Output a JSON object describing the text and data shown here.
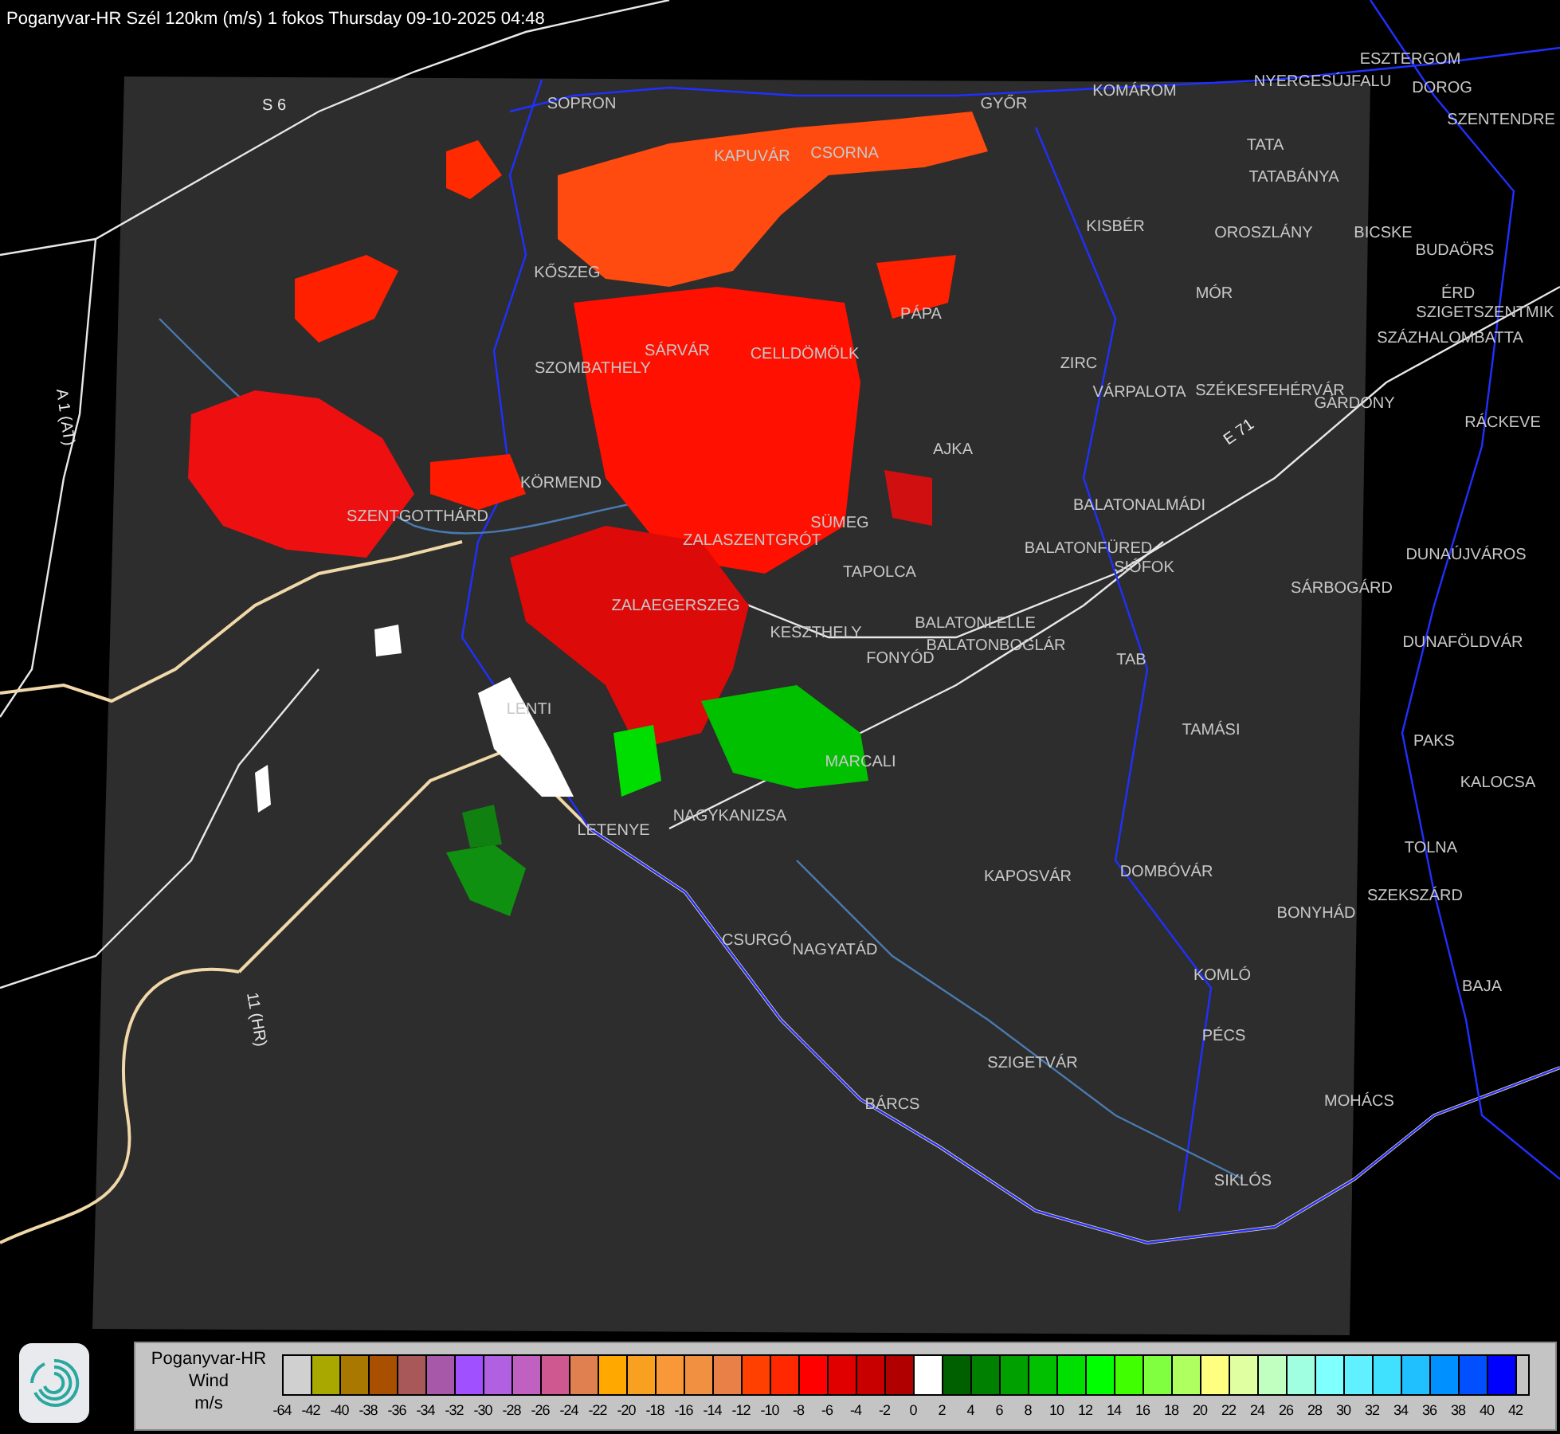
{
  "title": "Poganyvar-HR Szél 120km (m/s) 1 fokos Thursday 09-10-2025 04:48",
  "map": {
    "labels": [
      {
        "text": "S 6",
        "kind": "road"
      },
      {
        "text": "SOPRON",
        "kind": "city"
      },
      {
        "text": "KAPUVÁR",
        "kind": "city"
      },
      {
        "text": "CSORNA",
        "kind": "city"
      },
      {
        "text": "GYŐR",
        "kind": "city"
      },
      {
        "text": "KOMÁROM",
        "kind": "city"
      },
      {
        "text": "ESZTERGOM",
        "kind": "city"
      },
      {
        "text": "NYERGESÚJFALU",
        "kind": "city"
      },
      {
        "text": "DOROG",
        "kind": "city"
      },
      {
        "text": "SZENTENDRE",
        "kind": "city"
      },
      {
        "text": "TATA",
        "kind": "city"
      },
      {
        "text": "TATABÁNYA",
        "kind": "city"
      },
      {
        "text": "KISBÉR",
        "kind": "city"
      },
      {
        "text": "OROSZLÁNY",
        "kind": "city"
      },
      {
        "text": "BICSKE",
        "kind": "city"
      },
      {
        "text": "BUDAÖRS",
        "kind": "city"
      },
      {
        "text": "ÉRD",
        "kind": "city"
      },
      {
        "text": "SZIGETSZENTMIK",
        "kind": "city"
      },
      {
        "text": "SZÁZHALOMBATTA",
        "kind": "city"
      },
      {
        "text": "MÓR",
        "kind": "city"
      },
      {
        "text": "KŐSZEG",
        "kind": "city"
      },
      {
        "text": "PÁPA",
        "kind": "city"
      },
      {
        "text": "SÁRVÁR",
        "kind": "city"
      },
      {
        "text": "CELLDÖMÖLK",
        "kind": "city"
      },
      {
        "text": "SZOMBATHELY",
        "kind": "city"
      },
      {
        "text": "ZIRC",
        "kind": "city"
      },
      {
        "text": "VÁRPALOTA",
        "kind": "city"
      },
      {
        "text": "SZÉKESFEHÉRVÁR",
        "kind": "city"
      },
      {
        "text": "GÁRDONY",
        "kind": "city"
      },
      {
        "text": "RÁCKEVE",
        "kind": "city"
      },
      {
        "text": "AJKA",
        "kind": "city"
      },
      {
        "text": "KÖRMEND",
        "kind": "city"
      },
      {
        "text": "SZENTGOTTHÁRD",
        "kind": "city"
      },
      {
        "text": "BALATONALMÁDI",
        "kind": "city"
      },
      {
        "text": "SÜMEG",
        "kind": "city"
      },
      {
        "text": "ZALASZENTGRÓT",
        "kind": "city"
      },
      {
        "text": "BALATONFÜRED",
        "kind": "city"
      },
      {
        "text": "DUNAÚJVÁROS",
        "kind": "city"
      },
      {
        "text": "SIÓFOK",
        "kind": "city"
      },
      {
        "text": "TAPOLCA",
        "kind": "city"
      },
      {
        "text": "SÁRBOGÁRD",
        "kind": "city"
      },
      {
        "text": "ZALAEGERSZEG",
        "kind": "city"
      },
      {
        "text": "KESZTHELY",
        "kind": "city"
      },
      {
        "text": "BALATONLELLE",
        "kind": "city"
      },
      {
        "text": "BALATONBOGLÁR",
        "kind": "city"
      },
      {
        "text": "FONYÓD",
        "kind": "city"
      },
      {
        "text": "DUNAFÖLDVÁR",
        "kind": "city"
      },
      {
        "text": "TAB",
        "kind": "city"
      },
      {
        "text": "LENTI",
        "kind": "city"
      },
      {
        "text": "TAMÁSI",
        "kind": "city"
      },
      {
        "text": "PAKS",
        "kind": "city"
      },
      {
        "text": "MARCALI",
        "kind": "city"
      },
      {
        "text": "KALOCSA",
        "kind": "city"
      },
      {
        "text": "NAGYKANIZSA",
        "kind": "city"
      },
      {
        "text": "LETENYE",
        "kind": "city"
      },
      {
        "text": "TOLNA",
        "kind": "city"
      },
      {
        "text": "KAPOSVÁR",
        "kind": "city"
      },
      {
        "text": "DOMBÓVÁR",
        "kind": "city"
      },
      {
        "text": "SZEKSZÁRD",
        "kind": "city"
      },
      {
        "text": "BONYHÁD",
        "kind": "city"
      },
      {
        "text": "CSURGÓ",
        "kind": "city"
      },
      {
        "text": "NAGYATÁD",
        "kind": "city"
      },
      {
        "text": "KOMLÓ",
        "kind": "city"
      },
      {
        "text": "BAJA",
        "kind": "city"
      },
      {
        "text": "PÉCS",
        "kind": "city"
      },
      {
        "text": "SZIGETVÁR",
        "kind": "city"
      },
      {
        "text": "MOHÁCS",
        "kind": "city"
      },
      {
        "text": "BÁRCS",
        "kind": "city"
      },
      {
        "text": "SIKLÓS",
        "kind": "city"
      },
      {
        "text": "11 (HR)",
        "kind": "road"
      },
      {
        "text": "A 1 (AT)",
        "kind": "road"
      },
      {
        "text": "E 71",
        "kind": "road"
      }
    ]
  },
  "legend": {
    "title_lines": [
      "Poganyvar-HR",
      "Wind",
      "m/s"
    ],
    "swatches": [
      {
        "color": "#d0d0d0"
      },
      {
        "color": "#a8a800"
      },
      {
        "color": "#a87800"
      },
      {
        "color": "#a85000"
      },
      {
        "color": "#a85858"
      },
      {
        "color": "#a858a8"
      },
      {
        "color": "#a050ff"
      },
      {
        "color": "#b060e0"
      },
      {
        "color": "#c060c0"
      },
      {
        "color": "#d05890"
      },
      {
        "color": "#e08050"
      },
      {
        "color": "#ffa800"
      },
      {
        "color": "#f8a020"
      },
      {
        "color": "#f89838"
      },
      {
        "color": "#f09040"
      },
      {
        "color": "#e88048"
      },
      {
        "color": "#ff4000"
      },
      {
        "color": "#ff2800"
      },
      {
        "color": "#ff0000"
      },
      {
        "color": "#e00000"
      },
      {
        "color": "#c80000"
      },
      {
        "color": "#b00000"
      },
      {
        "color": "#ffffff"
      },
      {
        "color": "#006000"
      },
      {
        "color": "#008000"
      },
      {
        "color": "#00a000"
      },
      {
        "color": "#00c000"
      },
      {
        "color": "#00e000"
      },
      {
        "color": "#00ff00"
      },
      {
        "color": "#40ff00"
      },
      {
        "color": "#80ff40"
      },
      {
        "color": "#b0ff60"
      },
      {
        "color": "#ffff80"
      },
      {
        "color": "#e0ffa0"
      },
      {
        "color": "#c0ffc0"
      },
      {
        "color": "#a0ffe0"
      },
      {
        "color": "#80ffff"
      },
      {
        "color": "#60f0ff"
      },
      {
        "color": "#40e0ff"
      },
      {
        "color": "#20c0ff"
      },
      {
        "color": "#0090ff"
      },
      {
        "color": "#0050ff"
      },
      {
        "color": "#0000ff"
      }
    ],
    "ticks": [
      "-64",
      "-42",
      "-40",
      "-38",
      "-36",
      "-34",
      "-32",
      "-30",
      "-28",
      "-26",
      "-24",
      "-22",
      "-20",
      "-18",
      "-16",
      "-14",
      "-12",
      "-10",
      "-8",
      "-6",
      "-4",
      "-2",
      "0",
      "2",
      "4",
      "6",
      "8",
      "10",
      "12",
      "14",
      "16",
      "18",
      "20",
      "22",
      "24",
      "26",
      "28",
      "30",
      "32",
      "34",
      "36",
      "38",
      "40",
      "42"
    ]
  }
}
